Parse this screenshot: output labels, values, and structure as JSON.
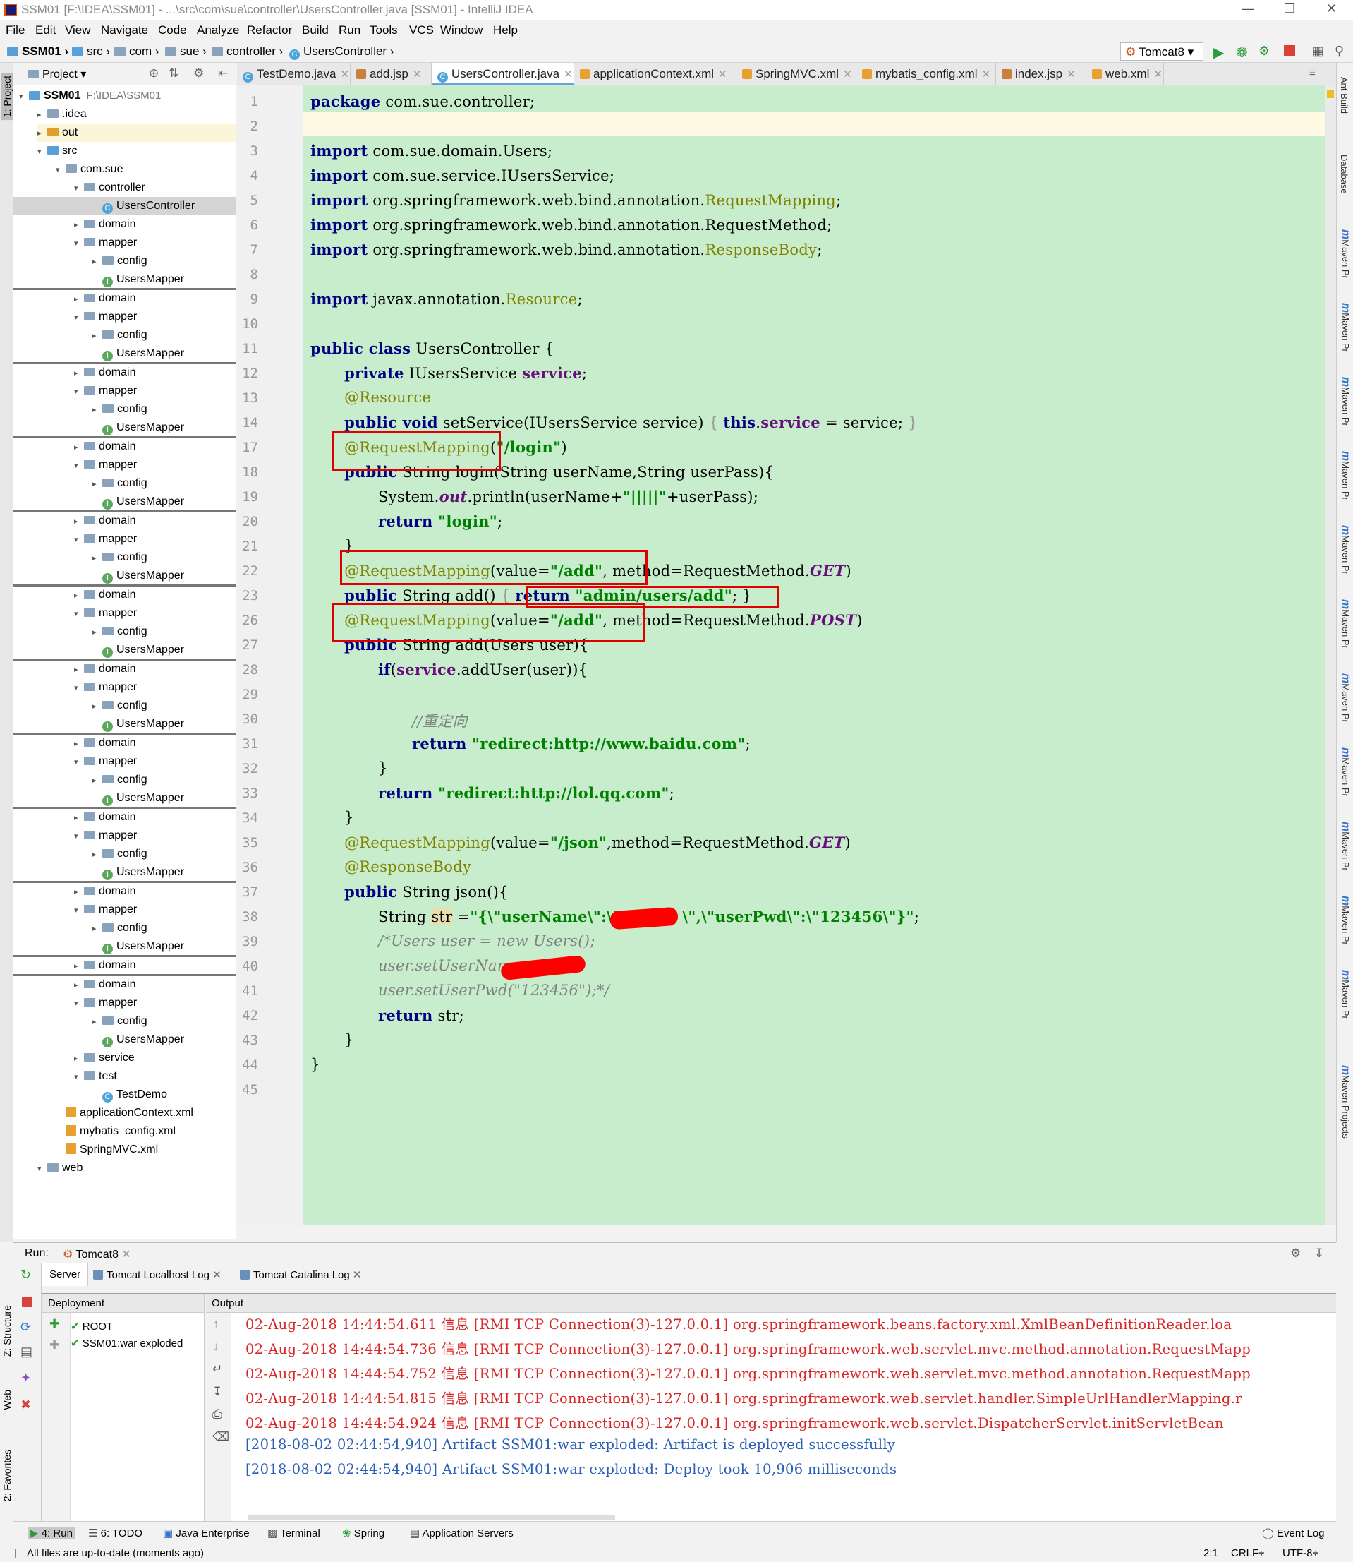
{
  "window": {
    "title": "SSM01 [F:\\IDEA\\SSM01] - ...\\src\\com\\sue\\controller\\UsersController.java [SSM01] - IntelliJ IDEA"
  },
  "menu": [
    "File",
    "Edit",
    "View",
    "Navigate",
    "Code",
    "Analyze",
    "Refactor",
    "Build",
    "Run",
    "Tools",
    "VCS",
    "Window",
    "Help"
  ],
  "breadcrumbs": [
    "SSM01",
    "src",
    "com",
    "sue",
    "controller",
    "UsersController"
  ],
  "run_config": "Tomcat8",
  "project_panel": {
    "title": "Project",
    "root": "SSM01",
    "root_path": "F:\\IDEA\\SSM01",
    "items": {
      "idea": ".idea",
      "out": "out",
      "src": "src",
      "pkg": "com.sue",
      "controller": "controller",
      "users_controller": "UsersController",
      "domain": "domain",
      "mapper": "mapper",
      "config": "config",
      "users_mapper": "UsersMapper",
      "service": "service",
      "test": "test",
      "test_demo": "TestDemo",
      "app_ctx": "applicationContext.xml",
      "mybatis": "mybatis_config.xml",
      "springmvc": "SpringMVC.xml",
      "web": "web"
    }
  },
  "editor_tabs": [
    "TestDemo.java",
    "add.jsp",
    "UsersController.java",
    "applicationContext.xml",
    "SpringMVC.xml",
    "mybatis_config.xml",
    "index.jsp",
    "web.xml"
  ],
  "line_numbers": [
    "1",
    "2",
    "3",
    "4",
    "5",
    "6",
    "7",
    "8",
    "9",
    "10",
    "11",
    "12",
    "13",
    "14",
    "17",
    "18",
    "19",
    "20",
    "21",
    "22",
    "23",
    "26",
    "27",
    "28",
    "29",
    "30",
    "31",
    "32",
    "33",
    "34",
    "35",
    "36",
    "37",
    "38",
    "39",
    "40",
    "41",
    "42",
    "43",
    "44",
    "45"
  ],
  "code": {
    "l1a": "package",
    "l1b": " com.sue.controller;",
    "imp": "import",
    "l3": " com.sue.domain.Users;",
    "l4": " com.sue.service.IUsersService;",
    "l5a": " org.springframework.web.bind.annotation.",
    "l5b": "RequestMapping",
    "semi": ";",
    "l6": " org.springframework.web.bind.annotation.RequestMethod;",
    "l7a": " org.springframework.web.bind.annotation.",
    "l7b": "ResponseBody",
    "l9a": " javax.annotation.",
    "l9b": "Resource",
    "l11a": "public class",
    "l11b": " UsersController {",
    "l12a": "private",
    "l12b": " IUsersService ",
    "l12c": "service",
    "l13": "@Resource",
    "l14a": "public void",
    "l14b": " setService(IUsersService service) ",
    "l14c": "{ ",
    "l14d": "this",
    "l14e": ".",
    "l14f": "service",
    "l14g": " = service; ",
    "l14h": "}",
    "l17a": "@RequestMapping",
    "l17b": "(",
    "l17c": "\"/login\"",
    "l17d": ")",
    "l18a": "public",
    "l18b": " String login(String userName,String userPass){",
    "l19a": "System.",
    "l19b": "out",
    "l19c": ".println(userName+",
    "l19d": "\"|||||\"",
    "l19e": "+userPass);",
    "l20a": "return",
    "l20b": " \"login\"",
    "l20c": ";",
    "l21": "}",
    "l22a": "@RequestMapping",
    "l22b": "(value=",
    "l22c": "\"/add\"",
    "l22d": ", method=RequestMethod.",
    "l22e": "GET",
    "l22f": ")",
    "l23a": "public",
    "l23b": " String add() ",
    "l23c": "{ ",
    "l23d": "return",
    "l23e": " \"admin/users/add\"",
    "l23f": "; }",
    "l26e": "POST",
    "l27a": "public",
    "l27b": " String add(Users user){",
    "l28a": "if",
    "l28b": "(",
    "l28c": "service",
    "l28d": ".addUser(user)){",
    "l30": "//重定向",
    "l31a": "return",
    "l31b": " \"redirect:http://www.baidu.com\"",
    "l32": "}",
    "l33a": "return",
    "l33b": " \"redirect:http://lol.qq.com\"",
    "l34": "}",
    "l35a": "@RequestMapping",
    "l35b": "(value=",
    "l35c": "\"/json\"",
    "l35d": ",method=RequestMethod.",
    "l35e": "GET",
    "l35f": ")",
    "l36": "@ResponseBody",
    "l37a": "public",
    "l37b": " String json(){",
    "l38a": "String ",
    "l38b": "str",
    "l38c": " =",
    "l38d": "\"{\\\"userName\\\":\\\"",
    "l38e": "\\\",\\\"userPwd\\\":\\\"123456\\\"}\"",
    "l38f": ";",
    "l39": "/*Users user = new Users();",
    "l40": "user.setUserName",
    "l41": "user.setUserPwd(\"123456\");*/",
    "l42a": "return",
    "l42b": " str;",
    "l43": "}",
    "l44": "}"
  },
  "run_panel": {
    "label": "Run:",
    "config": "Tomcat8",
    "tabs": [
      "Server",
      "Tomcat Localhost Log",
      "Tomcat Catalina Log"
    ],
    "deployment_header": "Deployment",
    "output_header": "Output",
    "deployments": [
      "ROOT",
      "SSM01:war exploded"
    ],
    "log_lines": [
      "02-Aug-2018 14:44:54.611 信息 [RMI TCP Connection(3)-127.0.0.1] org.springframework.beans.factory.xml.XmlBeanDefinitionReader.loa",
      "02-Aug-2018 14:44:54.736 信息 [RMI TCP Connection(3)-127.0.0.1] org.springframework.web.servlet.mvc.method.annotation.RequestMapp",
      "02-Aug-2018 14:44:54.752 信息 [RMI TCP Connection(3)-127.0.0.1] org.springframework.web.servlet.mvc.method.annotation.RequestMapp",
      "02-Aug-2018 14:44:54.815 信息 [RMI TCP Connection(3)-127.0.0.1] org.springframework.web.servlet.handler.SimpleUrlHandlerMapping.r",
      "02-Aug-2018 14:44:54.924 信息 [RMI TCP Connection(3)-127.0.0.1] org.springframework.web.servlet.DispatcherServlet.initServletBean",
      "[2018-08-02 02:44:54,940] Artifact SSM01:war exploded: Artifact is deployed successfully",
      "[2018-08-02 02:44:54,940] Artifact SSM01:war exploded: Deploy took 10,906 milliseconds"
    ]
  },
  "tool_windows_bottom": [
    "4: Run",
    "6: TODO",
    "Java Enterprise",
    "Terminal",
    "Spring",
    "Application Servers",
    "Event Log"
  ],
  "left_strip": [
    "1: Project",
    "Z: Structure",
    "Web",
    "2: Favorites"
  ],
  "right_strip": [
    "Ant Build",
    "Database",
    "Maven Pr",
    "Maven Projects"
  ],
  "status": {
    "message": "All files are up-to-date (moments ago)",
    "position": "2:1",
    "line_sep": "CRLF÷",
    "encoding": "UTF-8÷"
  },
  "colors": {
    "editor_bg": "#c7edcc",
    "keyword": "#000080",
    "annotation": "#808000",
    "string": "#008000",
    "field": "#660e7a",
    "highlight_box": "#e00000",
    "log_red": "#d82828",
    "log_blue": "#2a5fb8"
  }
}
